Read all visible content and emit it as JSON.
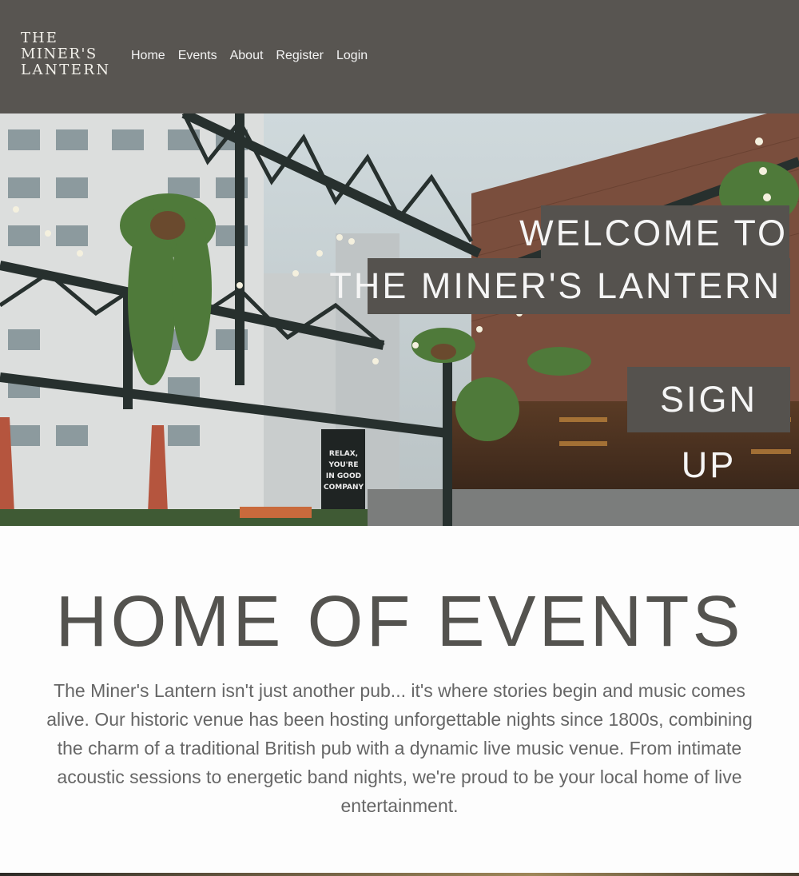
{
  "header": {
    "logo": {
      "line1": "THE",
      "line2": "MINER'S",
      "line3": "LANTERN"
    },
    "nav": [
      {
        "label": "Home"
      },
      {
        "label": "Events"
      },
      {
        "label": "About"
      },
      {
        "label": "Register"
      },
      {
        "label": "Login"
      }
    ]
  },
  "hero": {
    "welcome_line1": "WELCOME TO",
    "welcome_line2": "THE MINER'S LANTERN",
    "signup_label": "SIGN UP",
    "image_sign": [
      "RELAX,",
      "YOU'RE",
      "IN GOOD",
      "COMPANY"
    ]
  },
  "main": {
    "title": "HOME OF EVENTS",
    "intro": "The Miner's Lantern isn't just another pub... it's where stories begin and music comes alive. Our historic venue has been hosting unforgettable nights since 1800s, combining the charm of a traditional British pub with a dynamic live music venue. From intimate acoustic sessions to energetic band nights, we're proud to be your local home of live entertainment."
  },
  "colors": {
    "header_bg": "#585551",
    "overlay_bg": "#55524e",
    "text_dark": "#54534f"
  }
}
